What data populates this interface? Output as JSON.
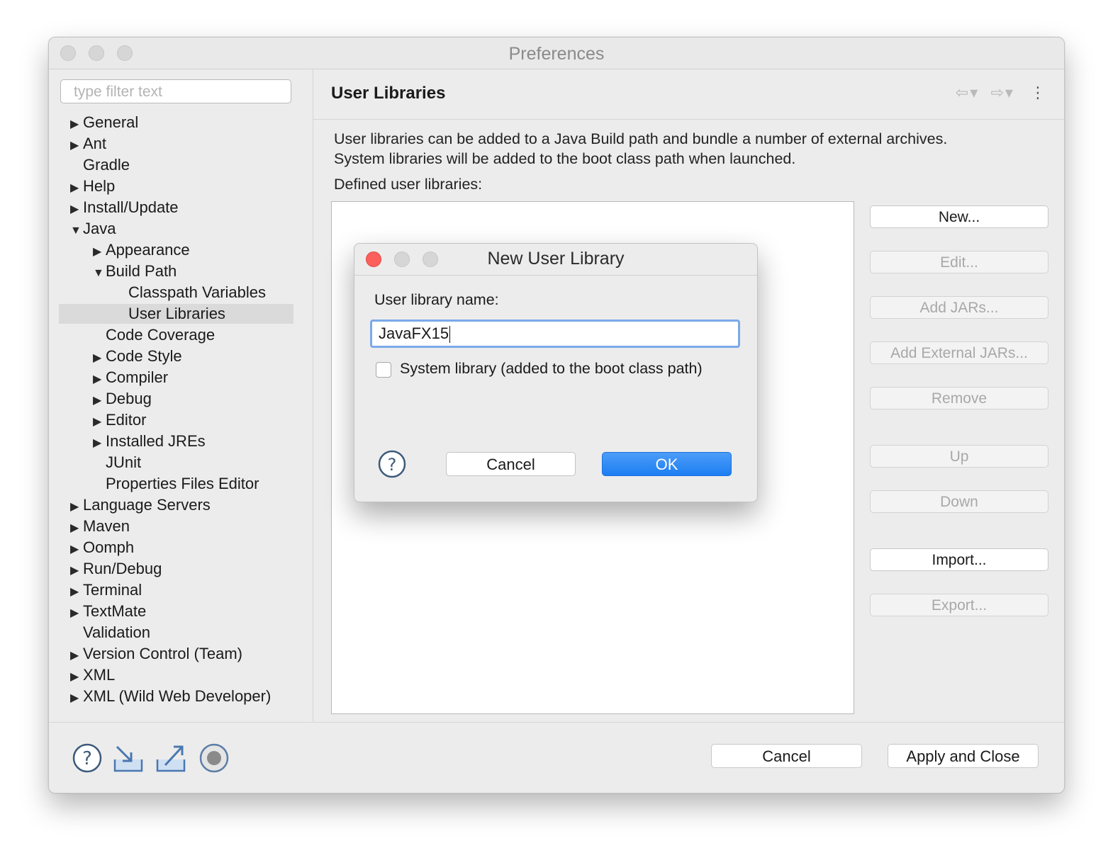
{
  "window": {
    "title": "Preferences"
  },
  "sidebar": {
    "filter_placeholder": "type filter text",
    "items": [
      {
        "label": "General",
        "expander": "▶"
      },
      {
        "label": "Ant",
        "expander": "▶"
      },
      {
        "label": "Gradle",
        "expander": ""
      },
      {
        "label": "Help",
        "expander": "▶"
      },
      {
        "label": "Install/Update",
        "expander": "▶"
      },
      {
        "label": "Java",
        "expander": "▼"
      },
      {
        "label": "Appearance",
        "expander": "▶"
      },
      {
        "label": "Build Path",
        "expander": "▼"
      },
      {
        "label": "Classpath Variables",
        "expander": ""
      },
      {
        "label": "User Libraries",
        "expander": ""
      },
      {
        "label": "Code Coverage",
        "expander": ""
      },
      {
        "label": "Code Style",
        "expander": "▶"
      },
      {
        "label": "Compiler",
        "expander": "▶"
      },
      {
        "label": "Debug",
        "expander": "▶"
      },
      {
        "label": "Editor",
        "expander": "▶"
      },
      {
        "label": "Installed JREs",
        "expander": "▶"
      },
      {
        "label": "JUnit",
        "expander": ""
      },
      {
        "label": "Properties Files Editor",
        "expander": ""
      },
      {
        "label": "Language Servers",
        "expander": "▶"
      },
      {
        "label": "Maven",
        "expander": "▶"
      },
      {
        "label": "Oomph",
        "expander": "▶"
      },
      {
        "label": "Run/Debug",
        "expander": "▶"
      },
      {
        "label": "Terminal",
        "expander": "▶"
      },
      {
        "label": "TextMate",
        "expander": "▶"
      },
      {
        "label": "Validation",
        "expander": ""
      },
      {
        "label": "Version Control (Team)",
        "expander": "▶"
      },
      {
        "label": "XML",
        "expander": "▶"
      },
      {
        "label": "XML (Wild Web Developer)",
        "expander": "▶"
      }
    ]
  },
  "content": {
    "title": "User Libraries",
    "description_line1": "User libraries can be added to a Java Build path and bundle a number of external archives.",
    "description_line2": "System libraries will be added to the boot class path when launched.",
    "defined_label": "Defined user libraries:",
    "buttons": {
      "new": "New...",
      "edit": "Edit...",
      "add_jars": "Add JARs...",
      "add_external_jars": "Add External JARs...",
      "remove": "Remove",
      "up": "Up",
      "down": "Down",
      "import": "Import...",
      "export": "Export..."
    }
  },
  "footer": {
    "cancel": "Cancel",
    "apply_close": "Apply and Close"
  },
  "dialog": {
    "title": "New User Library",
    "name_label": "User library name:",
    "name_value": "JavaFX15",
    "system_library_label": "System library (added to the boot class path)",
    "system_library_checked": false,
    "cancel": "Cancel",
    "ok": "OK"
  },
  "colors": {
    "accent": "#1d7ef2",
    "close_red": "#fc605c",
    "focus_ring": "#7aa9ea"
  }
}
